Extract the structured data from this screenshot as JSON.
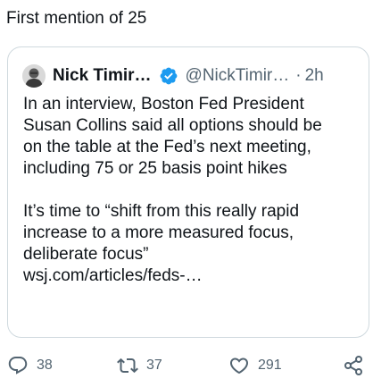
{
  "tweet": {
    "text": "First mention of 25"
  },
  "quoted_tweet": {
    "author_name": "Nick Timir…",
    "handle": "@NickTimir…",
    "separator": "·",
    "time": "2h",
    "verified": true,
    "body_lines": [
      "In an interview, Boston Fed President",
      "Susan Collins said all options should be",
      "on the table at the Fed’s next meeting,",
      "including 75 or 25 basis point hikes"
    ],
    "body_lines_2": [
      "It’s time to “shift from this really rapid",
      "increase to a more measured focus,",
      "deliberate focus”"
    ],
    "link_text": "wsj.com/articles/feds-…"
  },
  "actions": {
    "replies": "38",
    "retweets": "37",
    "likes": "291"
  },
  "colors": {
    "text": "#0f1419",
    "secondary": "#536471",
    "verified": "#1d9bf0",
    "border": "#cfd9de"
  },
  "icons": [
    "reply-icon",
    "retweet-icon",
    "like-icon",
    "share-icon",
    "verified-badge-icon"
  ]
}
